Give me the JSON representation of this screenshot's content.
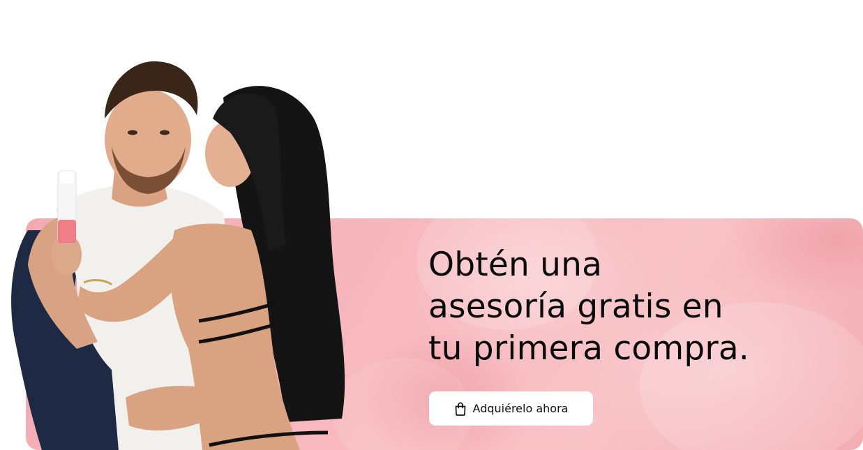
{
  "promo": {
    "headline_lines": [
      "Obtén una",
      "asesoría gratis en",
      "tu primera compra."
    ],
    "cta_label": "Adquiérelo ahora",
    "cta_icon": "shopping-bag-icon",
    "photo": "couple-with-product-photo"
  },
  "colors": {
    "banner_pink": "#f7b9bf",
    "text": "#0a0a0a",
    "button_bg": "#ffffff"
  }
}
